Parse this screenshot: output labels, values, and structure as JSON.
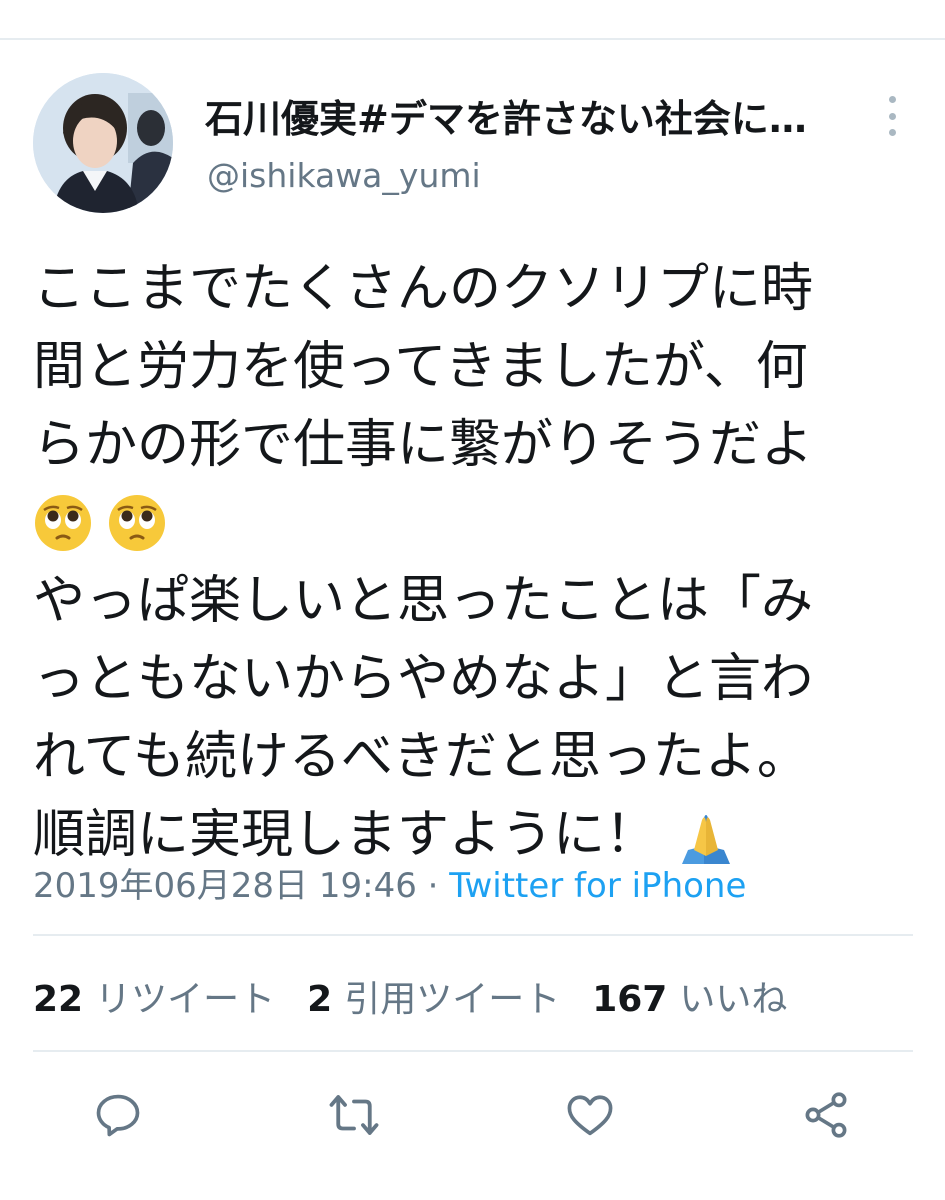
{
  "tweet": {
    "display_name": "石川優実#デマを許さない社会に…",
    "handle": "@ishikawa_yumi",
    "avatar_icon": "profile-photo",
    "more_icon": "vertical-ellipsis-icon",
    "body": {
      "line1": "ここまでたくさんのクソリプに時",
      "line2": "間と労力を使ってきましたが、何",
      "line3": "らかの形で仕事に繋がりそうだよ",
      "emoji_line": [
        "pleading-face-emoji",
        "pleading-face-emoji"
      ],
      "line5": "やっぱ楽しいと思ったことは「み",
      "line6": "っともないからやめなよ」と言わ",
      "line7": "れても続けるべきだと思ったよ。",
      "line8": "順調に実現しますように！",
      "trailing_emoji": "folded-hands-emoji"
    },
    "meta": {
      "timestamp": "2019年06月28日 19:46",
      "separator": " · ",
      "source": "Twitter for iPhone"
    },
    "stats": {
      "retweets_count": "22",
      "retweets_label": "リツイート",
      "quotes_count": "2",
      "quotes_label": "引用ツイート",
      "likes_count": "167",
      "likes_label": "いいね"
    },
    "actions": [
      "reply-icon",
      "retweet-icon",
      "like-icon",
      "share-icon"
    ]
  },
  "colors": {
    "text": "#14171a",
    "secondary": "#657786",
    "link": "#1da1f2",
    "divider": "#e6ecf0",
    "icon": "#657786"
  }
}
